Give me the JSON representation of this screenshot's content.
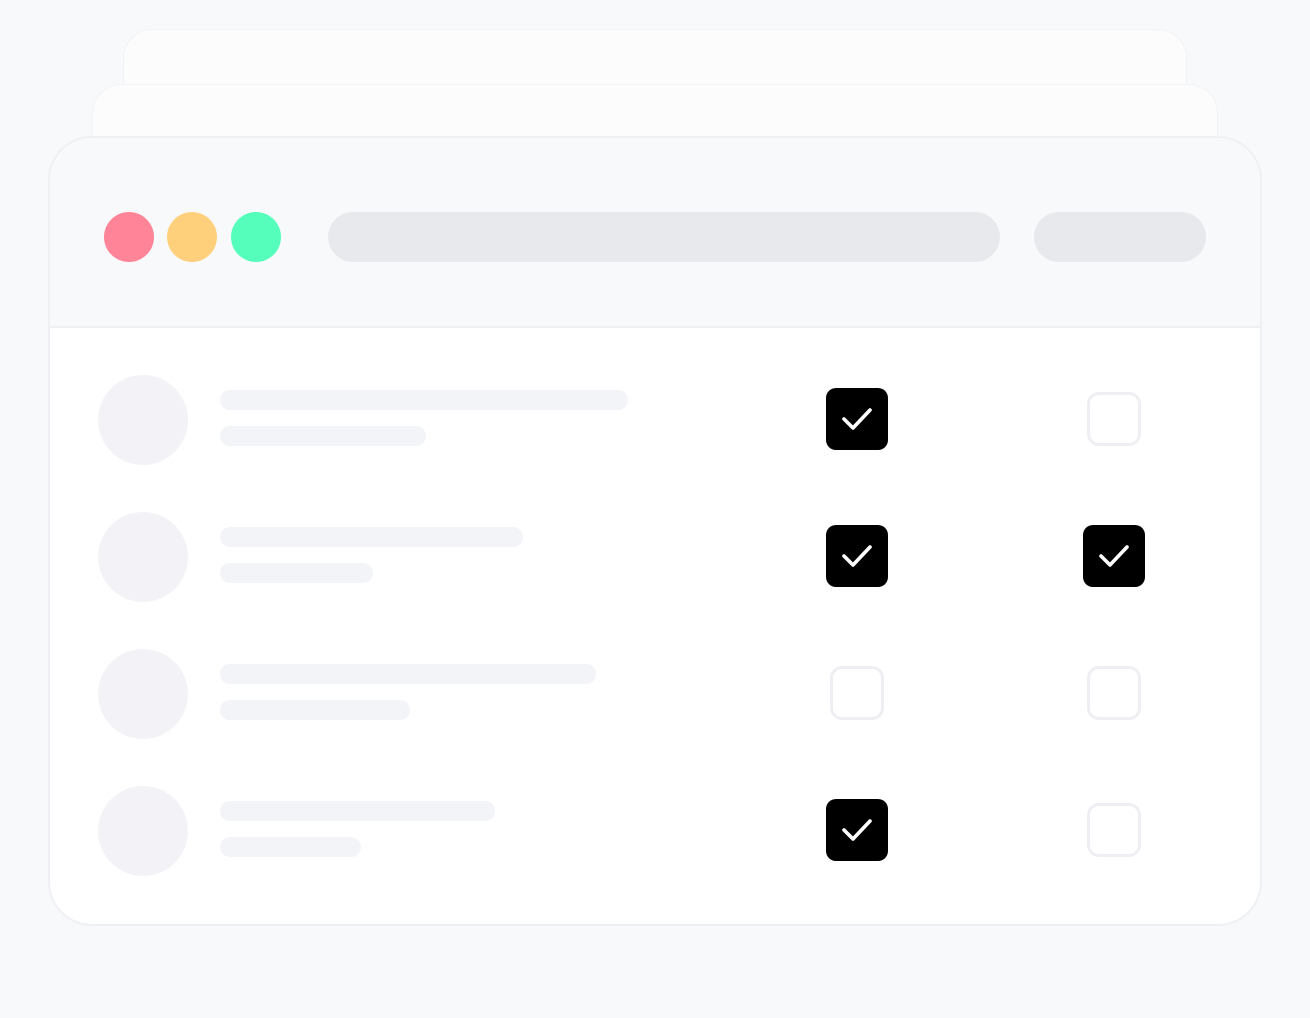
{
  "window": {
    "traffic_lights": [
      {
        "name": "close",
        "color": "#ff8498"
      },
      {
        "name": "minimize",
        "color": "#ffd07b"
      },
      {
        "name": "maximize",
        "color": "#55ffbb"
      }
    ],
    "accent_color": "#000000",
    "placeholder_color": "#e8e9ed"
  },
  "rows": [
    {
      "col_a_checked": true,
      "col_b_checked": false
    },
    {
      "col_a_checked": true,
      "col_b_checked": true
    },
    {
      "col_a_checked": false,
      "col_b_checked": false
    },
    {
      "col_a_checked": true,
      "col_b_checked": false
    }
  ],
  "icons": {
    "check": "check-icon"
  }
}
